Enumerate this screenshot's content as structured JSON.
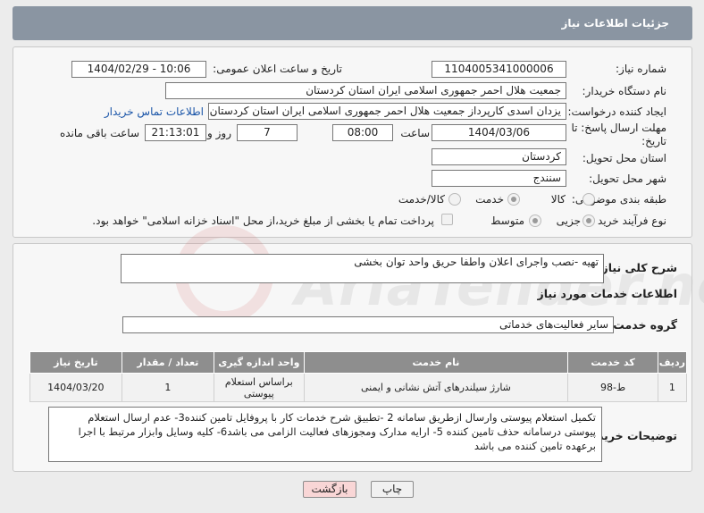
{
  "header": {
    "title": "جزئیات اطلاعات نیاز"
  },
  "fields": {
    "need_number_label": "شماره نیاز:",
    "need_number": "1104005341000006",
    "announce_label": "تاریخ و ساعت اعلان عمومی:",
    "announce_value": "1404/02/29 - 10:06",
    "buyer_org_label": "نام دستگاه خریدار:",
    "buyer_org": "جمعیت هلال احمر جمهوری اسلامی ایران استان کردستان",
    "creator_label": "ایجاد کننده درخواست:",
    "creator": "یزدان اسدی کارپرداز جمعیت هلال احمر جمهوری اسلامی ایران استان کردستان",
    "contact_link": "اطلاعات تماس خریدار",
    "deadline_label_line1": "مهلت ارسال پاسخ: تا",
    "deadline_label_line2": "تاریخ:",
    "deadline_date": "1404/03/06",
    "time_label": "ساعت",
    "deadline_time": "08:00",
    "days_value": "7",
    "days_label": "روز و",
    "remaining_time": "21:13:01",
    "remaining_label": "ساعت باقی مانده",
    "province_label": "استان محل تحویل:",
    "province": "کردستان",
    "city_label": "شهر محل تحویل:",
    "city": "سنندج",
    "category_label": "طبقه بندی موضوعی:",
    "category_options": [
      "کالا",
      "خدمت",
      "کالا/خدمت"
    ],
    "category_selected": "خدمت",
    "process_label": "نوع فرآیند خرید :",
    "process_options": [
      "جزیی",
      "متوسط"
    ],
    "process_selected": "جزیی",
    "payment_note": "پرداخت تمام یا بخشی از مبلغ خرید،از محل \"اسناد خزانه اسلامی\" خواهد بود."
  },
  "summary": {
    "label": "شرح کلی نیاز:",
    "text": "تهیه -نصب واجرای اعلان واطفا حریق واحد توان بخشی"
  },
  "services": {
    "section_title": "اطلاعات خدمات مورد نیاز",
    "group_label": "گروه خدمت:",
    "group_value": "سایر فعالیت‌های خدماتی",
    "columns": [
      "ردیف",
      "کد خدمت",
      "نام خدمت",
      "واحد اندازه گیری",
      "تعداد / مقدار",
      "تاریخ نیاز"
    ],
    "rows": [
      {
        "row": "1",
        "code": "ط-98",
        "name": "شارژ سیلندرهای آتش نشانی و ایمنی",
        "unit": "براساس استعلام پیوستی",
        "qty": "1",
        "date": "1404/03/20"
      }
    ]
  },
  "buyer_notes": {
    "label": "توضیحات خریدار:",
    "text": "تکمیل استعلام پیوستی وارسال ازطریق سامانه 2 -تطبیق شرح خدمات کار با پروفایل تامین کننده3- عدم ارسال استعلام پیوستی درسامانه حذف تامین کننده 5- ارایه مدارک ومجوزهای فعالیت الزامی می باشد6- کلیه وسایل وابزار مرتبط با اجرا برعهده تامین کننده می باشد"
  },
  "buttons": {
    "print": "چاپ",
    "back": "بازگشت"
  },
  "watermark": {
    "text": "AriaTender.net"
  },
  "colors": {
    "header": "#8a95a2",
    "table_header": "#8e8e8e",
    "link": "#1a55a8",
    "back_button": "#f9d6d6"
  }
}
